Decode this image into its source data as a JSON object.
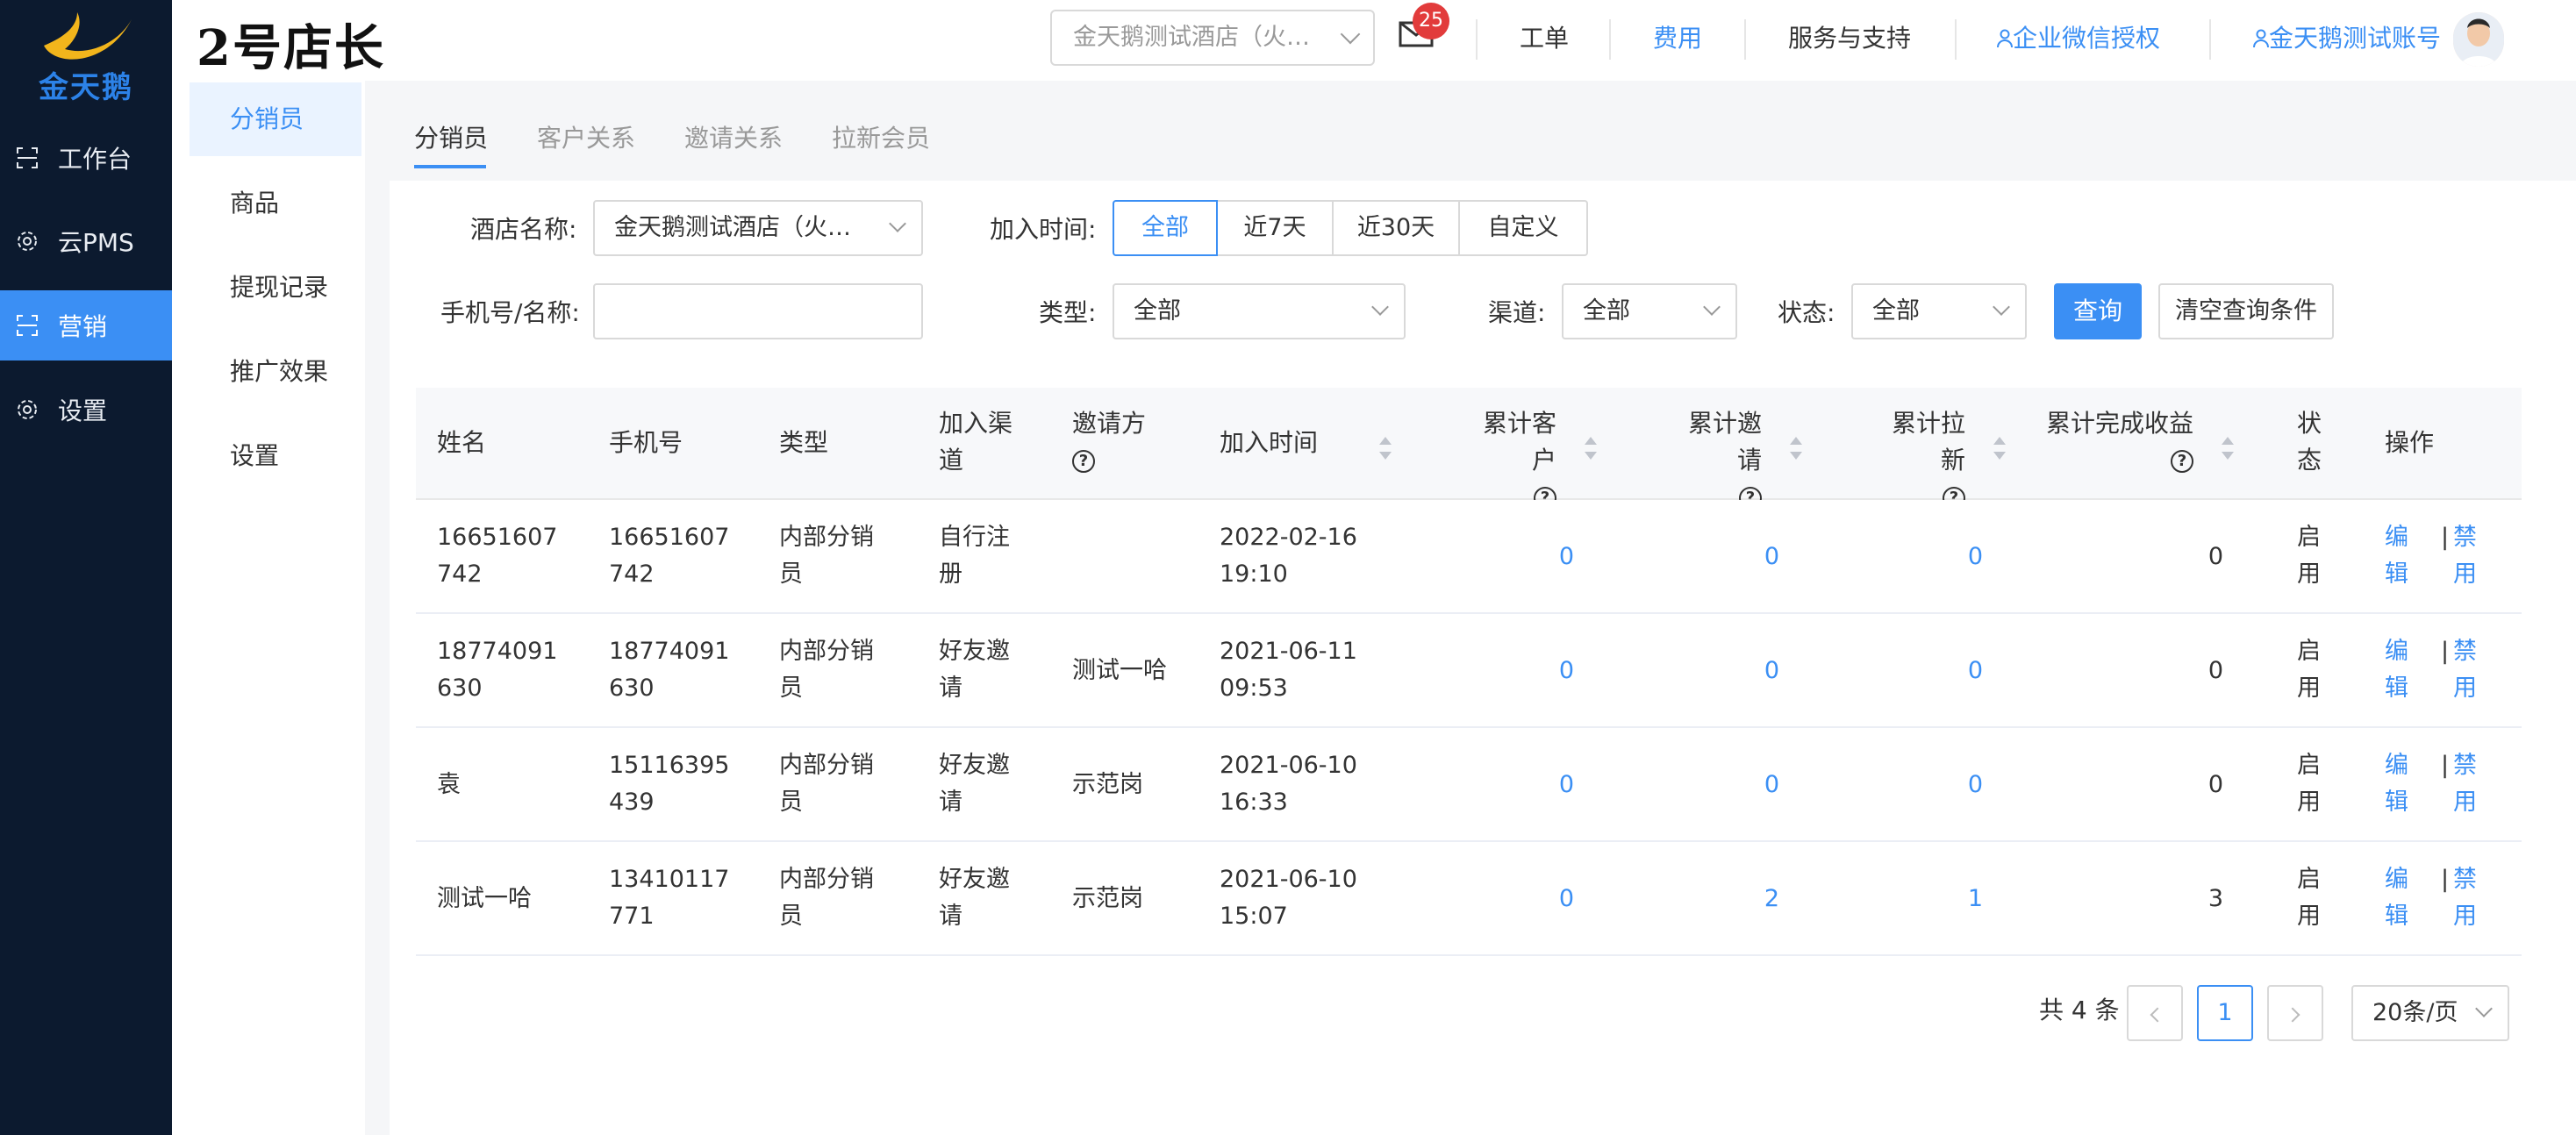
{
  "brand": {
    "logo_text": "金天鹅",
    "app_title": "2号店长",
    "accent": "#3b8ff4",
    "nav_bg": "#0c1a2f"
  },
  "header": {
    "hotel_select": "金天鹅测试酒店（火车站店）",
    "mail_badge": "25",
    "links": {
      "ticket": "工单",
      "fee": "费用",
      "support": "服务与支持",
      "wecom": "企业微信授权",
      "account": "金天鹅测试账号"
    }
  },
  "sidebar": {
    "items": [
      {
        "label": "工作台",
        "icon": "workbench-icon"
      },
      {
        "label": "云PMS",
        "icon": "gear-icon"
      },
      {
        "label": "营销",
        "icon": "marketing-icon"
      },
      {
        "label": "设置",
        "icon": "gear-icon"
      }
    ],
    "active_index": 2
  },
  "subnav": {
    "items": [
      "分销员",
      "商品",
      "提现记录",
      "推广效果",
      "设置"
    ],
    "active_index": 0
  },
  "tabs": {
    "items": [
      "分销员",
      "客户关系",
      "邀请关系",
      "拉新会员"
    ],
    "active_index": 0
  },
  "filters": {
    "hotel_label": "酒店名称:",
    "hotel_value": "金天鹅测试酒店（火车站店）",
    "join_time_label": "加入时间:",
    "join_time_options": [
      "全部",
      "近7天",
      "近30天",
      "自定义"
    ],
    "join_time_active": 0,
    "phone_label": "手机号/名称:",
    "phone_value": "",
    "type_label": "类型:",
    "type_value": "全部",
    "channel_label": "渠道:",
    "channel_value": "全部",
    "status_label": "状态:",
    "status_value": "全部",
    "query_button": "查询",
    "clear_button": "清空查询条件"
  },
  "table": {
    "headers": {
      "name": "姓名",
      "phone": "手机号",
      "type": "类型",
      "channel": "加入渠道",
      "inviter": "邀请方",
      "join_time": "加入时间",
      "customers": "累计客户",
      "invites": "累计邀请",
      "new_members": "累计拉新",
      "earnings": "累计完成收益",
      "status": "状态",
      "actions": "操作"
    },
    "rows": [
      {
        "name": "16651607742",
        "phone": "16651607742",
        "type": "内部分销员",
        "channel": "自行注册",
        "inviter": "",
        "date": "2022-02-16",
        "time": "19:10",
        "customers": "0",
        "invites": "0",
        "new_members": "0",
        "earnings": "0",
        "status": "启用",
        "edit": "编辑",
        "disable": "禁用"
      },
      {
        "name": "18774091630",
        "phone": "18774091630",
        "type": "内部分销员",
        "channel": "好友邀请",
        "inviter": "测试一哈",
        "date": "2021-06-11",
        "time": "09:53",
        "customers": "0",
        "invites": "0",
        "new_members": "0",
        "earnings": "0",
        "status": "启用",
        "edit": "编辑",
        "disable": "禁用"
      },
      {
        "name": "袁",
        "phone": "15116395439",
        "type": "内部分销员",
        "channel": "好友邀请",
        "inviter": "示范岗",
        "date": "2021-06-10",
        "time": "16:33",
        "customers": "0",
        "invites": "0",
        "new_members": "0",
        "earnings": "0",
        "status": "启用",
        "edit": "编辑",
        "disable": "禁用"
      },
      {
        "name": "测试一哈",
        "phone": "13410117771",
        "type": "内部分销员",
        "channel": "好友邀请",
        "inviter": "示范岗",
        "date": "2021-06-10",
        "time": "15:07",
        "customers": "0",
        "invites": "2",
        "new_members": "1",
        "earnings": "3",
        "status": "启用",
        "edit": "编辑",
        "disable": "禁用"
      }
    ]
  },
  "pagination": {
    "total_text": "共 4 条",
    "current_page": "1",
    "page_size": "20条/页"
  }
}
